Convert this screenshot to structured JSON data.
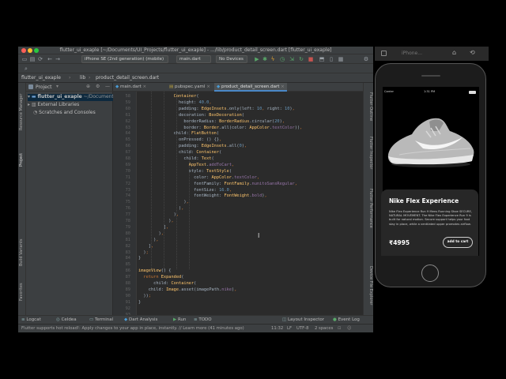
{
  "ide": {
    "window_title": "flutter_ui_exaple [~/Documents/UI_Projects/flutter_ui_exaple] - .../lib/product_detail_screen.dart [flutter_ui_exaple]",
    "toolbar": {
      "device": "iPhone SE (2nd generation) (mobile)",
      "run_config": "main.dart",
      "no_devices": "No Devices"
    },
    "breadcrumbs": [
      "flutter_ui_exaple",
      "lib",
      "product_detail_screen.dart"
    ],
    "project_panel": {
      "title": "Project",
      "root": "flutter_ui_exaple",
      "root_path": "~/Documents",
      "items": [
        "External Libraries",
        "Scratches and Consoles"
      ]
    },
    "left_tool_tabs": [
      "Resource Manager",
      "Project",
      "Build Variants",
      "Favorites",
      "Structure"
    ],
    "right_tool_tabs": [
      "Flutter Outline",
      "Flutter Inspector",
      "Flutter Performance",
      "Device File Explorer"
    ],
    "editor_tabs": [
      {
        "label": "main.dart",
        "active": false
      },
      {
        "label": "pubspec.yaml",
        "active": false
      },
      {
        "label": "product_detail_screen.dart",
        "active": true
      }
    ],
    "line_numbers": [
      "58",
      "59",
      "60",
      "61",
      "62",
      "63",
      "64",
      "65",
      "66",
      "67",
      "68",
      "69",
      "70",
      "71",
      "72",
      "73",
      "74",
      "75",
      "76",
      "77",
      "78",
      "79",
      "80",
      "81",
      "82",
      "83",
      "84",
      "85",
      "86",
      "87",
      "88",
      "89",
      "90",
      "91",
      "92",
      "93",
      "94"
    ],
    "code_lines": [
      "              Container(",
      "                height: 40.0,",
      "                padding: EdgeInsets.only(left: 10, right: 10),",
      "                decoration: BoxDecoration(",
      "                  borderRadius: BorderRadius.circular(20),",
      "                  border: Border.all(color: AppColor.textColor)),",
      "              child: FlatButton(",
      "                onPressed: () {},",
      "                padding: EdgeInsets.all(0),",
      "                child: Container(",
      "                  child: Text(",
      "                    AppText.addToCart,",
      "                    style: TextStyle(",
      "                      color: AppColor.textColor,",
      "                      fontFamily: FontFamily.nunitoSansRegular,",
      "                      fontSize: 16.0,",
      "                      fontWeight: FontWeight.bold),",
      "                  ),",
      "                ),",
      "              ),",
      "            ),",
      "          ],",
      "        ),",
      "      ),",
      "    ],",
      "  );",
      "}",
      "",
      "imageView() {",
      "  return Expanded(",
      "      child: Container(",
      "    child: Image.asset(imagePath.nike),",
      "  ));",
      "}",
      "",
      "",
      ""
    ],
    "bottom_tabs": [
      "Logcat",
      "Celdea",
      "Terminal",
      "Dart Analysis",
      "Run",
      "TODO",
      "Layout Inspector",
      "Event Log"
    ],
    "status": {
      "message": "Flutter supports hot reload!: Apply changes to your app in place, instantly. // Learn more (41 minutes ago)",
      "position": "11:32",
      "line_sep": "LF",
      "encoding": "UTF-8",
      "indent": "2 spaces"
    }
  },
  "simulator": {
    "title": "iPhone...",
    "status_bar": {
      "carrier": "Carrier",
      "time": "1:31 PM"
    },
    "product": {
      "name": "Nike Flex Experience",
      "description": "Nike Flex Experience Run 9 Mens Running Shoe SECURE, NATURAL MOVEMENT. The Nike Flex Experience Run 9 is built for natural motion. Secure support helps your foot stay in place, while a ventilated upper promotes airflow.",
      "price": "₹4995",
      "add_to_cart": "add to cart"
    }
  },
  "colors": {
    "editor_bg": "#2b2b2b",
    "panel_bg": "#3c3f41",
    "keyword": "#cc7832",
    "class": "#ffc66d",
    "number": "#6897bb",
    "field": "#9876aa",
    "accent": "#4a88c7"
  }
}
